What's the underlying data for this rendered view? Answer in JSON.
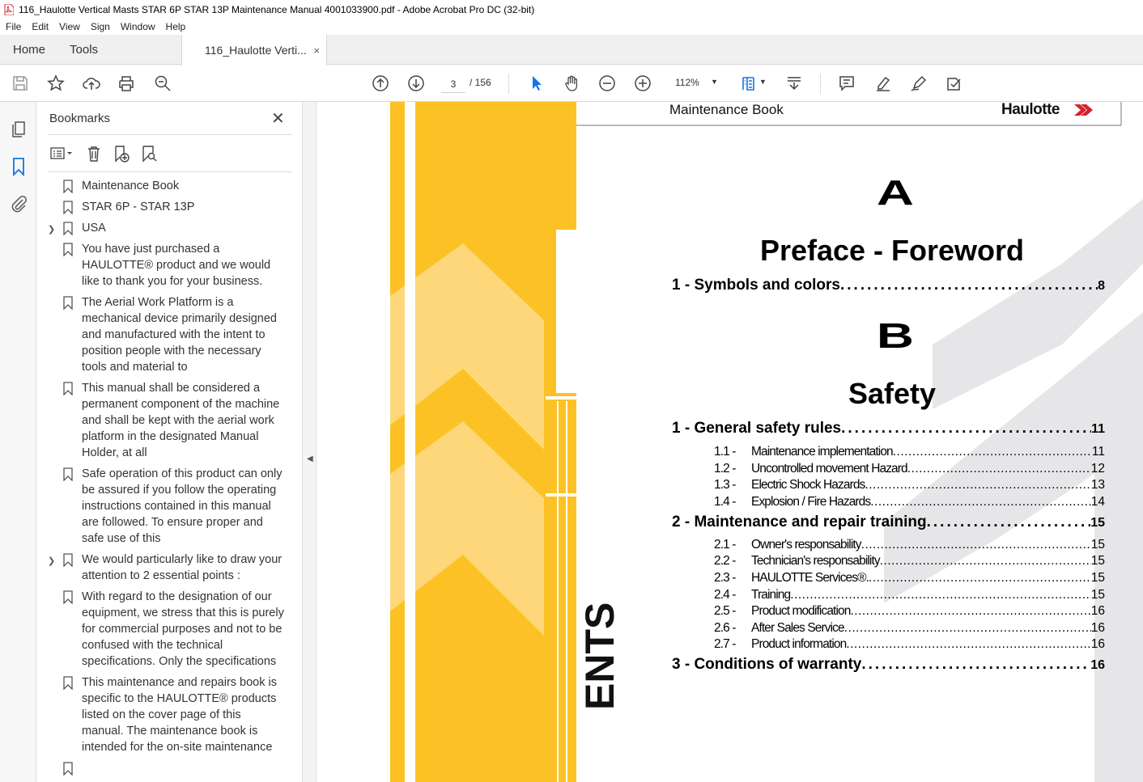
{
  "window": {
    "title": "116_Haulotte Vertical Masts STAR 6P STAR 13P Maintenance Manual 4001033900.pdf - Adobe Acrobat Pro DC (32-bit)"
  },
  "menu": [
    "File",
    "Edit",
    "View",
    "Sign",
    "Window",
    "Help"
  ],
  "tabs": {
    "home": "Home",
    "tools": "Tools",
    "doc": "116_Haulotte Verti...",
    "close": "×"
  },
  "toolbar": {
    "page_current": "3",
    "page_total": "/  156",
    "zoom": "112%"
  },
  "bookmarks": {
    "title": "Bookmarks",
    "items": [
      {
        "label": "Maintenance Book",
        "expandable": false
      },
      {
        "label": "STAR 6P - STAR 13P",
        "expandable": false
      },
      {
        "label": "USA",
        "expandable": true
      },
      {
        "label": "You have just purchased a HAULOTTE® product and we would like to thank you for your business.",
        "expandable": false
      },
      {
        "label": "The Aerial Work Platform is a mechanical device primarily designed and manufactured with the intent to position people with the necessary tools and material to",
        "expandable": false
      },
      {
        "label": "This manual shall be considered a permanent component of the machine and shall be kept with the aerial work platform in the designated Manual Holder, at all",
        "expandable": false
      },
      {
        "label": "Safe operation of this product can only be assured if you follow the operating instructions contained in this manual are followed. To ensure proper and safe use of this",
        "expandable": false
      },
      {
        "label": "We would particularly like to draw your attention to 2 essential points :",
        "expandable": true
      },
      {
        "label": "With regard to the designation of our equipment, we stress that this is purely for commercial purposes and not to be confused with the technical specifications. Only the specifications",
        "expandable": false
      },
      {
        "label": "This maintenance and repairs book is specific to the HAULOTTE® products listed on the cover page of this manual. The maintenance book is intended for the on-site maintenance",
        "expandable": false
      },
      {
        "label": "",
        "expandable": false
      }
    ]
  },
  "document": {
    "header": "Maintenance Book",
    "brand": "Haulotte",
    "section_a_letter": "A",
    "section_a_title": "Preface - Foreword",
    "section_b_letter": "B",
    "section_b_title": "Safety",
    "vertical_text": "ENTS",
    "toc": [
      {
        "level": 1,
        "label": "1 - Symbols and colors",
        "page": "8"
      },
      {
        "level": 1,
        "label": "1 - General safety rules",
        "page": "11"
      },
      {
        "level": 2,
        "num": "1.1 -",
        "label": "Maintenance implementation",
        "page": "11"
      },
      {
        "level": 2,
        "num": "1.2 -",
        "label": "Uncontrolled movement Hazard",
        "page": "12"
      },
      {
        "level": 2,
        "num": "1.3 -",
        "label": "Electric Shock Hazards",
        "page": "13"
      },
      {
        "level": 2,
        "num": "1.4 -",
        "label": "Explosion / Fire Hazards",
        "page": "14"
      },
      {
        "level": 1,
        "label": "2 - Maintenance and repair training",
        "page": "15"
      },
      {
        "level": 2,
        "num": "2.1 -",
        "label": "Owner's responsability",
        "page": "15"
      },
      {
        "level": 2,
        "num": "2.2 -",
        "label": "Technician's responsability",
        "page": "15"
      },
      {
        "level": 2,
        "num": "2.3 -",
        "label": "HAULOTTE Services®.",
        "page": "15"
      },
      {
        "level": 2,
        "num": "2.4 -",
        "label": "Training",
        "page": "15"
      },
      {
        "level": 2,
        "num": "2.5 -",
        "label": "Product modification",
        "page": "16"
      },
      {
        "level": 2,
        "num": "2.6 -",
        "label": "After Sales Service",
        "page": "16"
      },
      {
        "level": 2,
        "num": "2.7 -",
        "label": "Product information",
        "page": "16"
      },
      {
        "level": 1,
        "label": "3 - Conditions of warranty",
        "page": "16"
      }
    ]
  },
  "colors": {
    "accent_yellow": "#fcc225",
    "light_yellow": "#fdd77a",
    "grey_chevron": "#e6e6e8",
    "acrobat_red": "#d3232a",
    "icon_blue": "#1473e6"
  }
}
